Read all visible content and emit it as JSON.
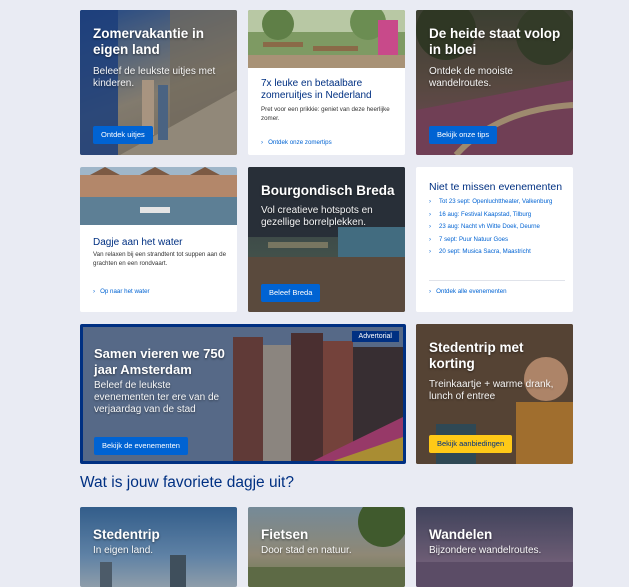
{
  "cards": {
    "zomervakantie": {
      "title": "Zomervakantie in eigen land",
      "text": "Beleef de leukste uitjes met kinderen.",
      "button": "Ontdek uitjes"
    },
    "zomeruitjes": {
      "title": "7x leuke en betaalbare zomeruitjes in Nederland",
      "text": "Pret voor een prikkie: geniet van deze heerlijke zomer.",
      "link": "Ontdek onze zomertips"
    },
    "heide": {
      "title": "De heide staat volop in bloei",
      "text": "Ontdek de mooiste wandelroutes.",
      "button": "Bekijk onze tips"
    },
    "water": {
      "title": "Dagje aan het water",
      "text": "Van relaxen bij een strandtent tot suppen aan de grachten en een rondvaart.",
      "link": "Op naar het water"
    },
    "breda": {
      "title": "Bourgondisch Breda",
      "text": "Vol creatieve hotspots en gezellige borrelplekken.",
      "button": "Beleef Breda"
    },
    "evenementen": {
      "title": "Niet te missen evenementen",
      "items": [
        "Tot 23 sept: Openluchttheater, Valkenburg",
        "16 aug: Festival Kaapstad, Tilburg",
        "23 aug: Nacht vh Witte Doek, Deurne",
        "7 sept: Puur Natuur Goes",
        "20 sept: Musica Sacra, Maastricht"
      ],
      "link": "Ontdek alle evenementen"
    },
    "amsterdam": {
      "badge": "Advertorial",
      "title": "Samen vieren we 750 jaar Amsterdam",
      "text": "Beleef de leukste evenementen ter ere van de verjaardag van de stad",
      "button": "Bekijk de evenementen"
    },
    "stedentrip_korting": {
      "title": "Stedentrip met korting",
      "text": "Treinkaartje + warme drank, lunch of entree",
      "button": "Bekijk aanbiedingen"
    }
  },
  "section": {
    "title": "Wat is jouw favoriete dagje uit?"
  },
  "favorites": [
    {
      "title": "Stedentrip",
      "text": "In eigen land."
    },
    {
      "title": "Fietsen",
      "text": "Door stad en natuur."
    },
    {
      "title": "Wandelen",
      "text": "Bijzondere wandelroutes."
    }
  ],
  "icons": {
    "chevron": "chevron-right-icon"
  },
  "colors": {
    "nav_blue": "#003082",
    "link_blue": "#0063d3",
    "yellow": "#ffc917",
    "background": "#e9ebf3"
  }
}
